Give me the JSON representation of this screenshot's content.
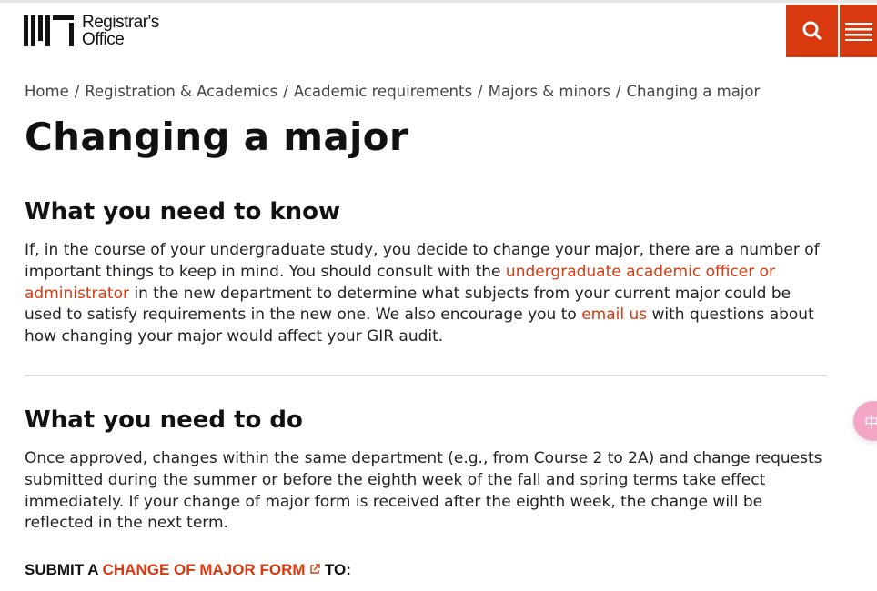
{
  "header": {
    "logo_text_line1": "Registrar's",
    "logo_text_line2": "Office",
    "logo_letters": "MIT"
  },
  "breadcrumb": [
    "Home",
    "Registration & Academics",
    "Academic requirements",
    "Majors & minors",
    "Changing a major"
  ],
  "page_title": "Changing a major",
  "section1": {
    "heading": "What you need to know",
    "text1": "If, in the course of your undergraduate study, you decide to change your major, there are a number of important things to keep in mind. You should consult with the ",
    "link1": "undergraduate academic officer or administrator",
    "text2": " in the new department to determine what subjects from your current major could be used to satisfy requirements in the new one. We also encourage you to ",
    "link2": "email us",
    "text3": " with questions about how changing your major would affect your GIR audit."
  },
  "section2": {
    "heading": "What you need to do",
    "text": "Once approved, changes within the same department (e.g., from Course 2 to 2A) and change requests submitted during the summer or before the eighth week of the fall and spring terms take effect immediately. If your change of major form is received after the eighth week, the change will be reflected in the next term.",
    "submit_prefix": "SUBMIT A ",
    "submit_link": "CHANGE OF MAJOR FORM",
    "submit_suffix": " TO:"
  },
  "float_button": {
    "label": "中"
  },
  "colors": {
    "accent": "#d9390e"
  }
}
